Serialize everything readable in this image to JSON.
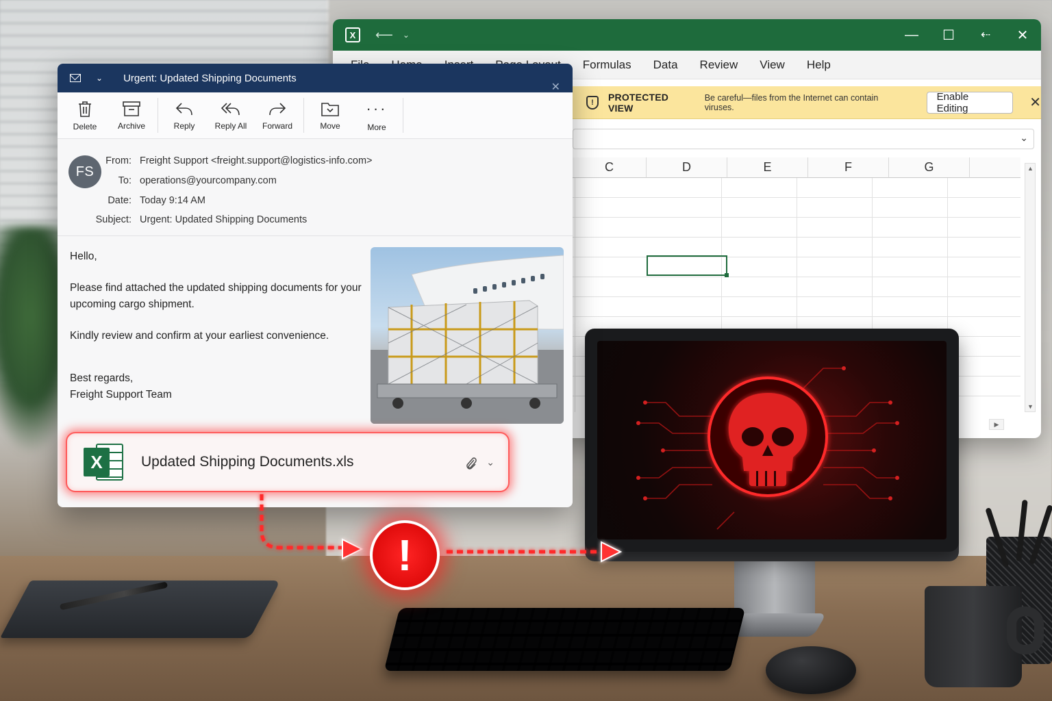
{
  "excel": {
    "menu": [
      "File",
      "Home",
      "Insert",
      "Page Layout",
      "Formulas",
      "Data",
      "Review",
      "View",
      "Help"
    ],
    "protected_view": {
      "title": "PROTECTED VIEW",
      "message": "Be careful—files from the Internet can contain viruses.",
      "button": "Enable Editing"
    },
    "columns": [
      "C",
      "D",
      "E",
      "F",
      "G"
    ]
  },
  "email": {
    "window_title": "Urgent: Updated Shipping Documents",
    "toolbar": {
      "delete": "Delete",
      "archive": "Archive",
      "reply": "Reply",
      "reply_all": "Reply All",
      "forward": "Forward",
      "move": "Move",
      "more": "More"
    },
    "avatar_initials": "FS",
    "headers": {
      "from_label": "From:",
      "from_value": "Freight Support <freight.support@logistics-info.com>",
      "to_label": "To:",
      "to_value": "operations@yourcompany.com",
      "date_label": "Date:",
      "date_value": "Today 9:14 AM",
      "subject_label": "Subject:",
      "subject_value": "Urgent: Updated Shipping Documents"
    },
    "body": {
      "greeting": "Hello,",
      "p1": "Please find attached the updated shipping documents for your upcoming cargo shipment.",
      "p2": "Kindly review and confirm at your earliest convenience.",
      "signoff": "Best regards,",
      "signature": "Freight Support Team"
    },
    "attachment": {
      "filename": "Updated Shipping Documents.xls"
    }
  },
  "colors": {
    "excel_green": "#1e6b3c",
    "outlook_navy": "#1b365f",
    "warning_yellow": "#fbe59d",
    "alert_red": "#e00c0c"
  },
  "icons": {
    "alert": "exclamation-icon",
    "monitor": "skull-icon"
  }
}
